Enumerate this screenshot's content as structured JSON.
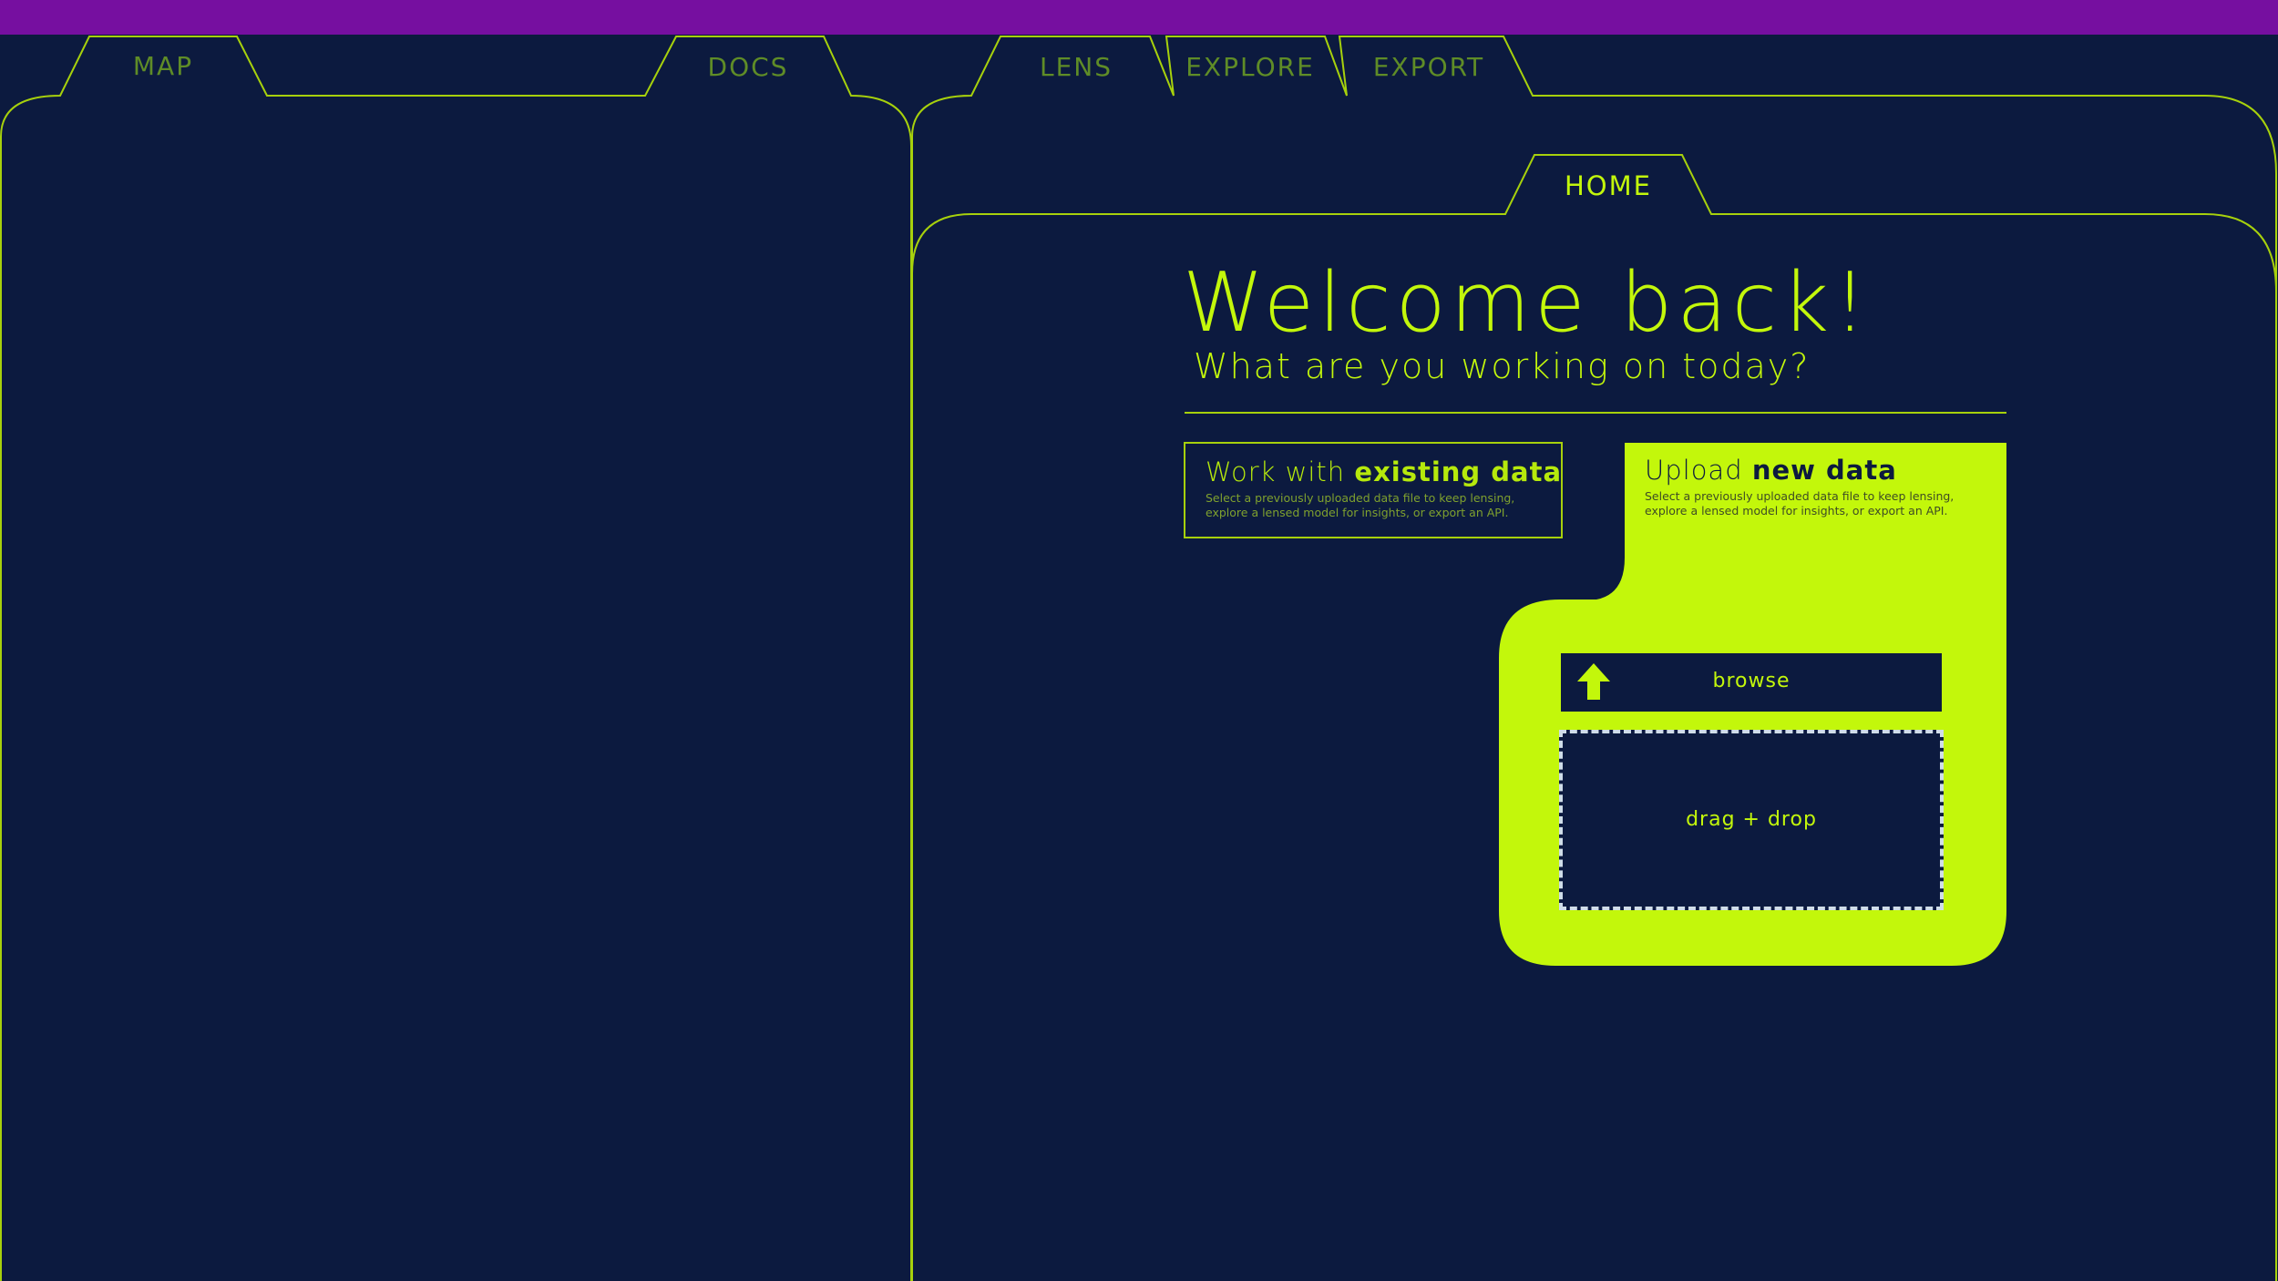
{
  "tabs": {
    "map": "MAP",
    "docs": "DOCS",
    "lens": "LENS",
    "explore": "EXPLORE",
    "export": "EXPORT",
    "home": "HOME"
  },
  "welcome": {
    "title": "Welcome back!",
    "subtitle": "What are you working on today?"
  },
  "existing_card": {
    "title_prefix": "Work with ",
    "title_bold": "existing data",
    "description": "Select a previously uploaded data file to keep lensing, explore a lensed model for insights, or export an API."
  },
  "upload_card": {
    "title_prefix": "Upload ",
    "title_bold": "new data",
    "description": "Select a previously uploaded data file to keep lensing, explore a lensed model for insights, or export an API."
  },
  "browse": {
    "label": "browse",
    "icon": "upload-arrow-icon"
  },
  "drop_zone": {
    "label": "drag + drop"
  },
  "colors": {
    "background": "#0c1a3f",
    "accent": "#c3f70b",
    "topbar": "#760fa0",
    "muted_tab": "#5f8c27"
  }
}
